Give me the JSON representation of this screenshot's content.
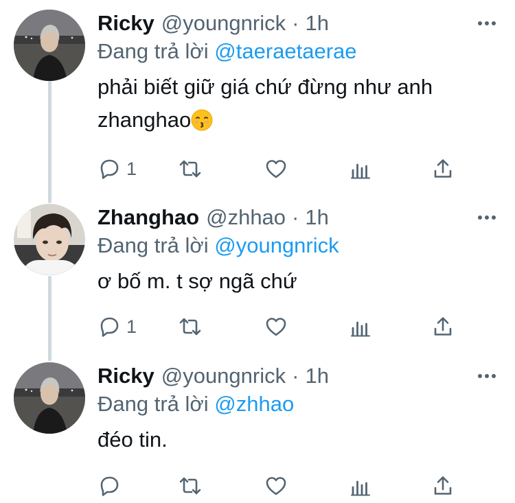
{
  "labels": {
    "replying_prefix": "Đang trả lời",
    "dot": "·"
  },
  "colors": {
    "link": "#1d9bf0",
    "secondary": "#536471",
    "thread_line": "#cfd9de"
  },
  "tweets": [
    {
      "name": "Ricky",
      "handle": "@youngnrick",
      "time": "1h",
      "reply_to": "@taeraetaerae",
      "text_line1": "phải biết giữ giá chứ đừng như anh",
      "text_line2": "zhanghao",
      "emoji": "kissing-face-emoji",
      "reply_count": "1"
    },
    {
      "name": "Zhanghao",
      "handle": "@zhhao",
      "time": "1h",
      "reply_to": "@youngnrick",
      "text_line1": "ơ bố m. t sợ ngã chứ",
      "reply_count": "1"
    },
    {
      "name": "Ricky",
      "handle": "@youngnrick",
      "time": "1h",
      "reply_to": "@zhhao",
      "text_line1": "đéo tin.",
      "reply_count": ""
    }
  ],
  "icons": {
    "reply": "reply-icon",
    "retweet": "retweet-icon",
    "like": "heart-icon",
    "views": "views-icon",
    "share": "share-icon",
    "more": "more-icon"
  }
}
